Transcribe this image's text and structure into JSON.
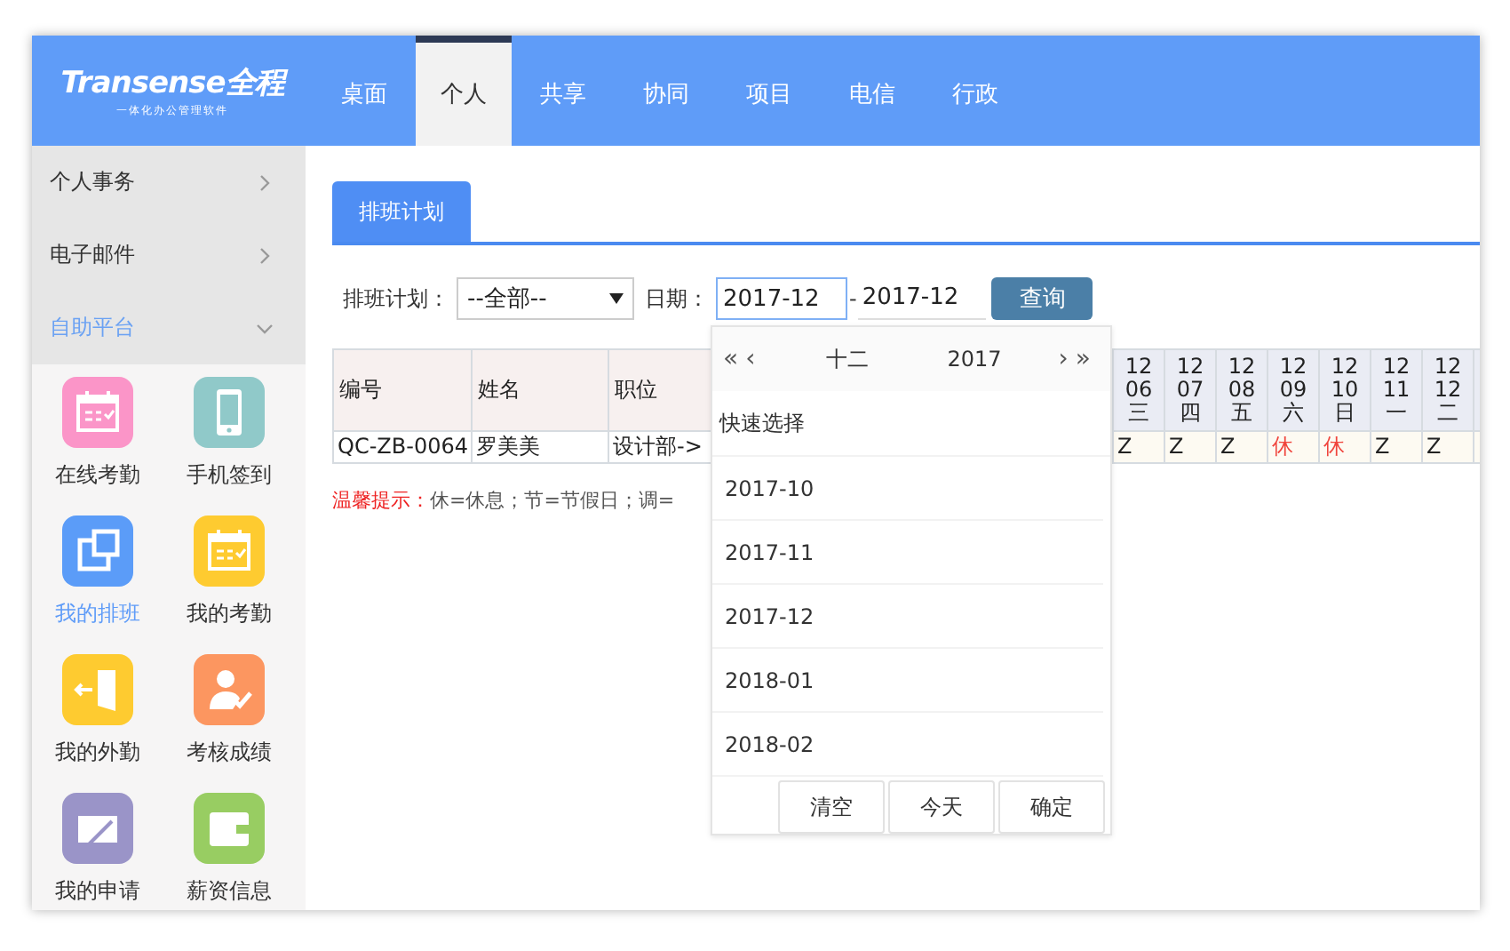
{
  "app": {
    "logo": "Transense全程",
    "tagline": "一体化办公管理软件"
  },
  "nav": [
    {
      "label": "桌面",
      "selected": false
    },
    {
      "label": "个人",
      "selected": true
    },
    {
      "label": "共享",
      "selected": false
    },
    {
      "label": "协同",
      "selected": false
    },
    {
      "label": "项目",
      "selected": false
    },
    {
      "label": "电信",
      "selected": false
    },
    {
      "label": "行政",
      "selected": false
    }
  ],
  "sidebar": {
    "menu": [
      {
        "label": "个人事务",
        "expanded": false
      },
      {
        "label": "电子邮件",
        "expanded": false
      },
      {
        "label": "自助平台",
        "expanded": true
      }
    ],
    "apps": [
      {
        "label": "在线考勤",
        "kind": "calendar",
        "color": "#fb95c8",
        "selected": false
      },
      {
        "label": "手机签到",
        "kind": "phone",
        "color": "#90c9c9",
        "selected": false
      },
      {
        "label": "我的排班",
        "kind": "windows",
        "color": "#5b9cf8",
        "selected": true
      },
      {
        "label": "我的考勤",
        "kind": "calendar",
        "color": "#fecb30",
        "selected": false
      },
      {
        "label": "我的外勤",
        "kind": "door",
        "color": "#fecb30",
        "selected": false
      },
      {
        "label": "考核成绩",
        "kind": "person",
        "color": "#fc9660",
        "selected": false
      },
      {
        "label": "我的申请",
        "kind": "pen",
        "color": "#9a94c8",
        "selected": false
      },
      {
        "label": "薪资信息",
        "kind": "wallet",
        "color": "#98cd62",
        "selected": false
      }
    ]
  },
  "tab": {
    "label": "排班计划",
    "selected": true
  },
  "filter": {
    "plan_label": "排班计划：",
    "plan_value": "--全部--",
    "date_label": "日期：",
    "date_from": "2017-12",
    "date_separator": "-",
    "date_to": "2017-12",
    "query_button": "查询"
  },
  "table": {
    "columns": [
      "编号",
      "姓名",
      "职位"
    ],
    "day_columns": [
      {
        "month": "12",
        "day": "06",
        "weekday": "三"
      },
      {
        "month": "12",
        "day": "07",
        "weekday": "四"
      },
      {
        "month": "12",
        "day": "08",
        "weekday": "五"
      },
      {
        "month": "12",
        "day": "09",
        "weekday": "六"
      },
      {
        "month": "12",
        "day": "10",
        "weekday": "日"
      },
      {
        "month": "12",
        "day": "11",
        "weekday": "一"
      },
      {
        "month": "12",
        "day": "12",
        "weekday": "二"
      }
    ],
    "rows": [
      {
        "cells": [
          "QC-ZB-0064",
          "罗美美",
          "设计部->"
        ],
        "days": [
          {
            "text": "Z",
            "kind": "work"
          },
          {
            "text": "Z",
            "kind": "work"
          },
          {
            "text": "Z",
            "kind": "work"
          },
          {
            "text": "休",
            "kind": "rest"
          },
          {
            "text": "休",
            "kind": "rest"
          },
          {
            "text": "Z",
            "kind": "work"
          },
          {
            "text": "Z",
            "kind": "work"
          }
        ]
      }
    ]
  },
  "notice": {
    "label": "温馨提示：",
    "text": "休=休息；节=节假日；调="
  },
  "date_picker": {
    "prev_year": "«",
    "prev_month": "‹",
    "month": "十二",
    "year": "2017",
    "next_month": "›",
    "next_year": "»",
    "quick_title": "快速选择",
    "options": [
      "2017-10",
      "2017-11",
      "2017-12",
      "2018-01",
      "2018-02"
    ],
    "buttons": [
      "清空",
      "今天",
      "确定"
    ]
  }
}
